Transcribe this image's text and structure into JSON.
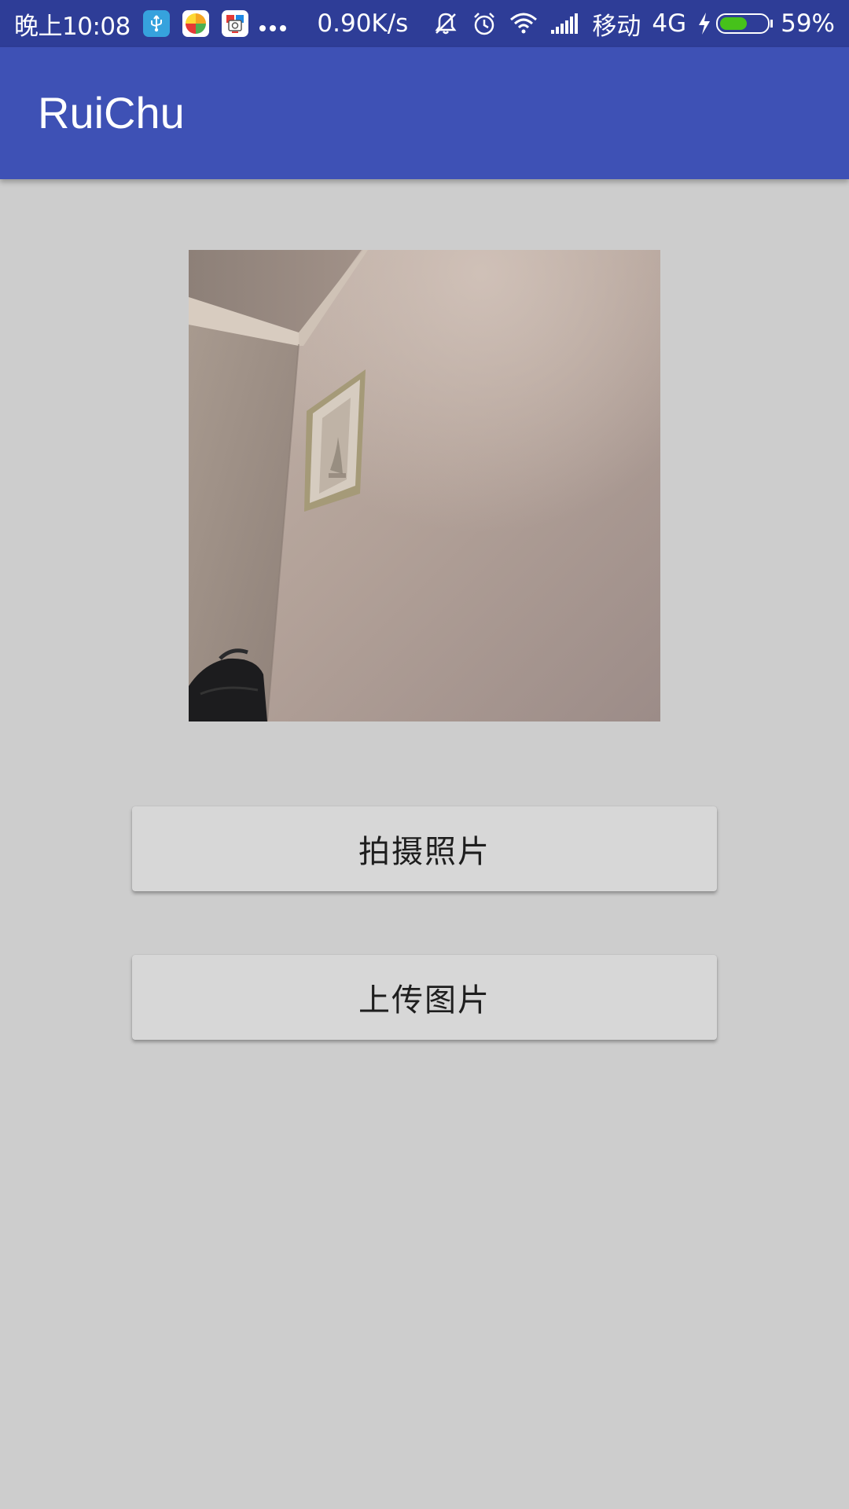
{
  "status_bar": {
    "time": "晚上10:08",
    "icons": [
      "usb-icon",
      "pinwheel-app-icon",
      "camera-app-icon",
      "more-notifications-icon"
    ],
    "net_speed": "0.90K/s",
    "right_icons": [
      "vibrate-off-icon",
      "alarm-icon",
      "wifi-icon",
      "signal-icon",
      "charging-icon"
    ],
    "carrier": "移动",
    "network_type": "4G",
    "battery_level": 0.59,
    "battery_text": "59%",
    "battery_color": "#46c21a",
    "bar_color": "#2e3d97"
  },
  "app_bar": {
    "title": "RuiChu",
    "color": "#3e51b5"
  },
  "main": {
    "photo": {
      "alt": "拍摄的照片"
    },
    "take_photo_button": "拍摄照片",
    "upload_image_button": "上传图片",
    "background_color": "#cdcdcd"
  }
}
